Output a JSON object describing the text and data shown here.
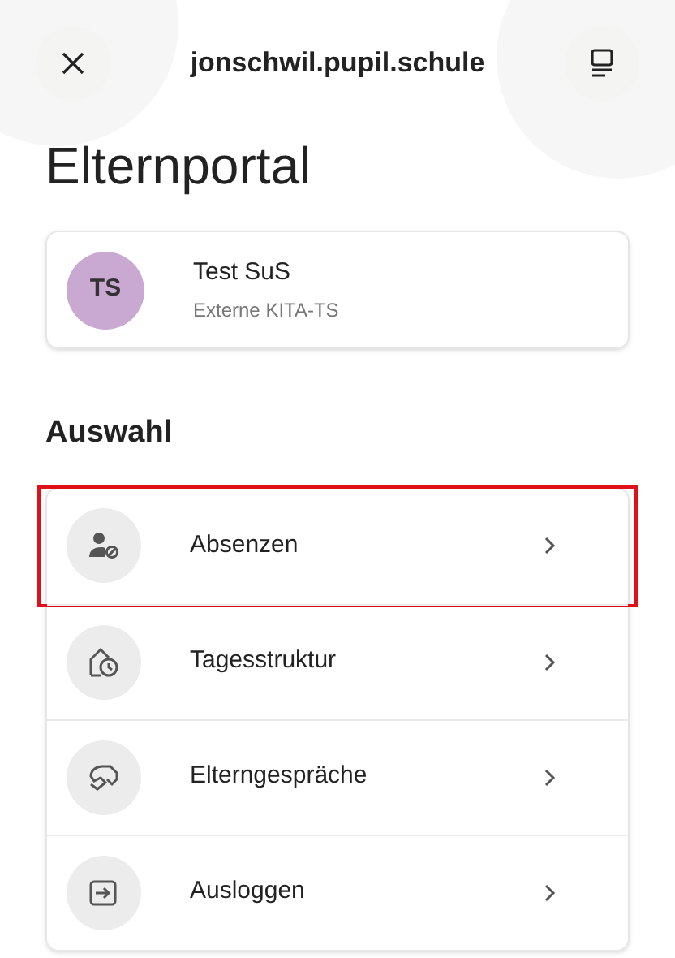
{
  "header": {
    "title": "jonschwil.pupil.schule"
  },
  "page_title": "Elternportal",
  "student": {
    "initials": "TS",
    "name": "Test SuS",
    "subtitle": "Externe KITA-TS"
  },
  "section_title": "Auswahl",
  "menu": [
    {
      "kind": "absence",
      "label": "Absenzen",
      "selected": true
    },
    {
      "kind": "daycare",
      "label": "Tagesstruktur",
      "selected": false
    },
    {
      "kind": "talk",
      "label": "Elterngespräche",
      "selected": false
    },
    {
      "kind": "logout",
      "label": "Ausloggen",
      "selected": false
    }
  ]
}
